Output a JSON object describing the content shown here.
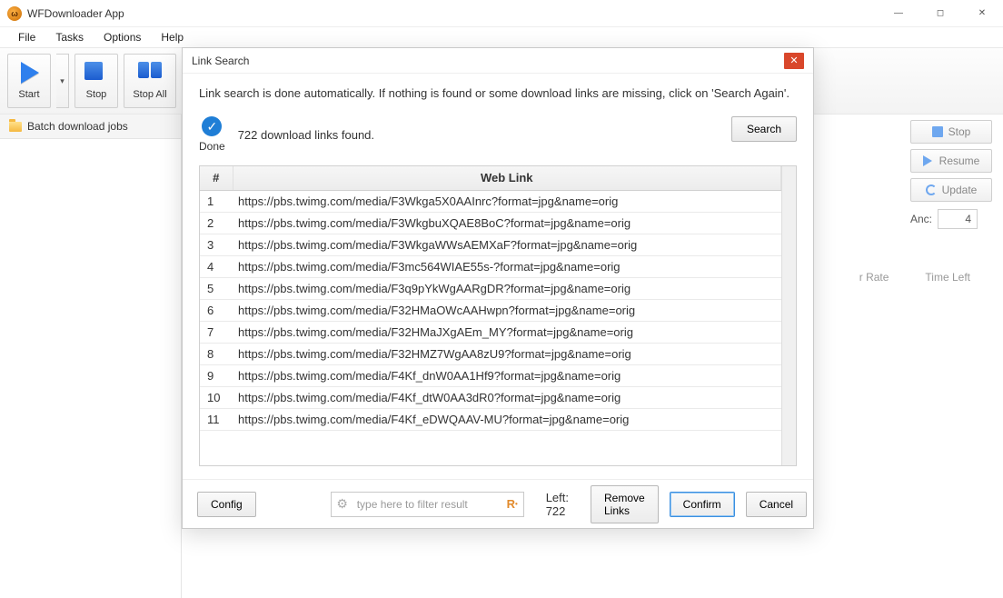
{
  "window": {
    "title": "WFDownloader App"
  },
  "menu": [
    "File",
    "Tasks",
    "Options",
    "Help"
  ],
  "toolbar": {
    "start": "Start",
    "stop": "Stop",
    "stopall": "Stop All"
  },
  "sidebar": {
    "batch": "Batch download jobs"
  },
  "side_actions": {
    "stop": "Stop",
    "resume": "Resume",
    "update": "Update"
  },
  "anc": {
    "label": "Anc:",
    "value": "4"
  },
  "bg_headers": {
    "rate": "r Rate",
    "time": "Time Left"
  },
  "dialog": {
    "title": "Link Search",
    "instruction": "Link search is done automatically. If nothing is found or some download links are missing, click on 'Search Again'.",
    "done": "Done",
    "found": "722 download links found.",
    "search": "Search",
    "filter_placeholder": "type here to filter result",
    "left_count": "Left: 722",
    "config": "Config",
    "remove": "Remove Links",
    "confirm": "Confirm",
    "cancel": "Cancel",
    "th_num": "#",
    "th_link": "Web Link",
    "rows": [
      {
        "n": "1",
        "url": "https://pbs.twimg.com/media/F3Wkga5X0AAInrc?format=jpg&name=orig"
      },
      {
        "n": "2",
        "url": "https://pbs.twimg.com/media/F3WkgbuXQAE8BoC?format=jpg&name=orig"
      },
      {
        "n": "3",
        "url": "https://pbs.twimg.com/media/F3WkgaWWsAEMXaF?format=jpg&name=orig"
      },
      {
        "n": "4",
        "url": "https://pbs.twimg.com/media/F3mc564WIAE55s-?format=jpg&name=orig"
      },
      {
        "n": "5",
        "url": "https://pbs.twimg.com/media/F3q9pYkWgAARgDR?format=jpg&name=orig"
      },
      {
        "n": "6",
        "url": "https://pbs.twimg.com/media/F32HMaOWcAAHwpn?format=jpg&name=orig"
      },
      {
        "n": "7",
        "url": "https://pbs.twimg.com/media/F32HMaJXgAEm_MY?format=jpg&name=orig"
      },
      {
        "n": "8",
        "url": "https://pbs.twimg.com/media/F32HMZ7WgAA8zU9?format=jpg&name=orig"
      },
      {
        "n": "9",
        "url": "https://pbs.twimg.com/media/F4Kf_dnW0AA1Hf9?format=jpg&name=orig"
      },
      {
        "n": "10",
        "url": "https://pbs.twimg.com/media/F4Kf_dtW0AA3dR0?format=jpg&name=orig"
      },
      {
        "n": "11",
        "url": "https://pbs.twimg.com/media/F4Kf_eDWQAAV-MU?format=jpg&name=orig"
      }
    ]
  }
}
